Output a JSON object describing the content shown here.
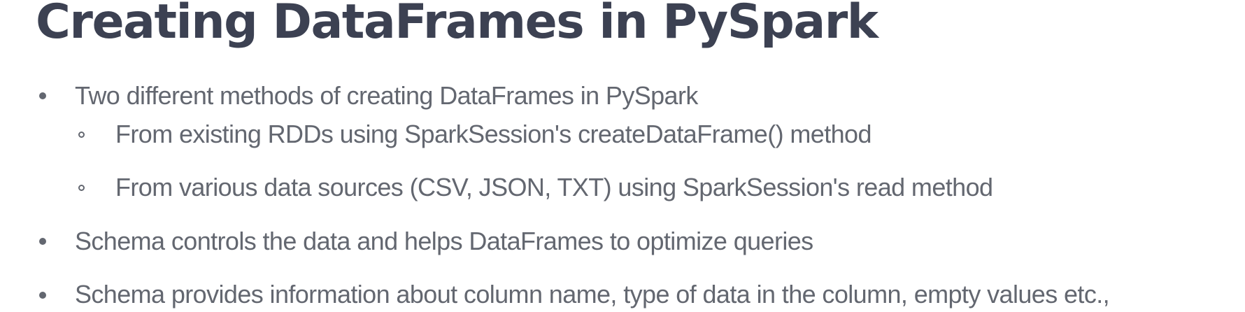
{
  "slide": {
    "title": "Creating DataFrames in PySpark",
    "bullets": [
      {
        "text": "Two different methods of creating DataFrames in PySpark",
        "sub_bullets": [
          "From existing RDDs using SparkSession's createDataFrame() method",
          "From various data sources (CSV, JSON, TXT) using SparkSession's read method"
        ]
      },
      {
        "text": "Schema controls the data and helps DataFrames to optimize queries",
        "sub_bullets": []
      },
      {
        "text": "Schema provides information about column name, type of data in the column, empty values etc.,",
        "sub_bullets": []
      }
    ]
  },
  "colors": {
    "title": "#3c4152",
    "body_text": "#636770",
    "background": "#ffffff"
  },
  "icons": {
    "level1_bullet": "filled-circle-bullet-icon",
    "level2_bullet": "hollow-circle-bullet-icon"
  }
}
